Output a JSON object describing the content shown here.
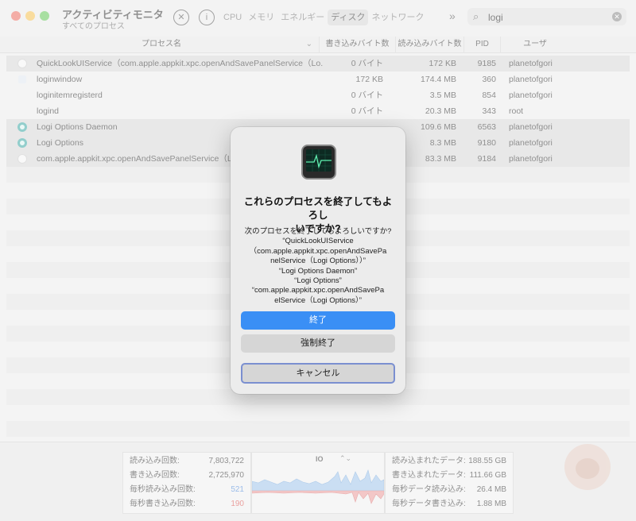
{
  "window": {
    "title": "アクティビティモニタ",
    "subtitle": "すべてのプロセス"
  },
  "toolbar": {
    "stop_icon": "stop-x-icon",
    "info_icon": "info-icon",
    "tabs": [
      "CPU",
      "メモリ",
      "エネルギー",
      "ディスク",
      "ネットワーク"
    ],
    "active_tab": "ディスク",
    "search_value": "logi"
  },
  "table": {
    "columns": [
      "プロセス名",
      "書き込みバイト数",
      "読み込みバイト数",
      "PID",
      "ユーザ"
    ],
    "rows": [
      {
        "name": "QuickLookUIService（com.apple.appkit.xpc.openAndSavePanelService（Lo...",
        "written": "0 バイト",
        "read": "172 KB",
        "pid": "9185",
        "user": "planetofgori",
        "icon": "white",
        "selected": true
      },
      {
        "name": "loginwindow",
        "written": "172 KB",
        "read": "174.4 MB",
        "pid": "360",
        "user": "planetofgori",
        "icon": "sq",
        "selected": false
      },
      {
        "name": "loginitemregisterd",
        "written": "0 バイト",
        "read": "3.5 MB",
        "pid": "854",
        "user": "planetofgori",
        "icon": "none",
        "selected": false
      },
      {
        "name": "logind",
        "written": "0 バイト",
        "read": "20.3 MB",
        "pid": "343",
        "user": "root",
        "icon": "none",
        "selected": false
      },
      {
        "name": "Logi Options Daemon",
        "written": "",
        "read": "109.6 MB",
        "pid": "6563",
        "user": "planetofgori",
        "icon": "logi",
        "selected": true
      },
      {
        "name": "Logi Options",
        "written": "",
        "read": "8.3 MB",
        "pid": "9180",
        "user": "planetofgori",
        "icon": "logi",
        "selected": true
      },
      {
        "name": "com.apple.appkit.xpc.openAndSavePanelService（Logi",
        "written": "",
        "read": "83.3 MB",
        "pid": "9184",
        "user": "planetofgori",
        "icon": "white",
        "selected": true
      }
    ]
  },
  "stats_left": [
    {
      "label": "読み込み回数:",
      "value": "7,803,722",
      "color": "#333333"
    },
    {
      "label": "書き込み回数:",
      "value": "2,725,970",
      "color": "#333333"
    },
    {
      "label": "毎秒読み込み回数:",
      "value": "521",
      "color": "#4a86d8"
    },
    {
      "label": "毎秒書き込み回数:",
      "value": "190",
      "color": "#d9534f"
    }
  ],
  "graph": {
    "mode": "IO",
    "read_color": "#9ec3ea",
    "write_color": "#e99a9a"
  },
  "stats_right": [
    {
      "label": "読み込まれたデータ:",
      "value": "188.55 GB"
    },
    {
      "label": "書き込まれたデータ:",
      "value": "111.66 GB"
    },
    {
      "label": "毎秒データ読み込み:",
      "value": "26.4 MB"
    },
    {
      "label": "毎秒データ書き込み:",
      "value": "1.88 MB"
    }
  ],
  "dialog": {
    "title_lines": [
      "これらのプロセスを終了してもよろし",
      "いですか?"
    ],
    "message_lines": [
      "次のプロセスを終了してもよろしいですか?",
      "“QuickLookUIService",
      "（com.apple.appkit.xpc.openAndSavePa",
      "nelService（Logi Options））”",
      "“Logi Options Daemon”",
      "“Logi Options”",
      "“com.apple.appkit.xpc.openAndSavePa",
      "elService（Logi Options）”"
    ],
    "quit_label": "終了",
    "force_quit_label": "強制終了",
    "cancel_label": "キャンセル"
  }
}
